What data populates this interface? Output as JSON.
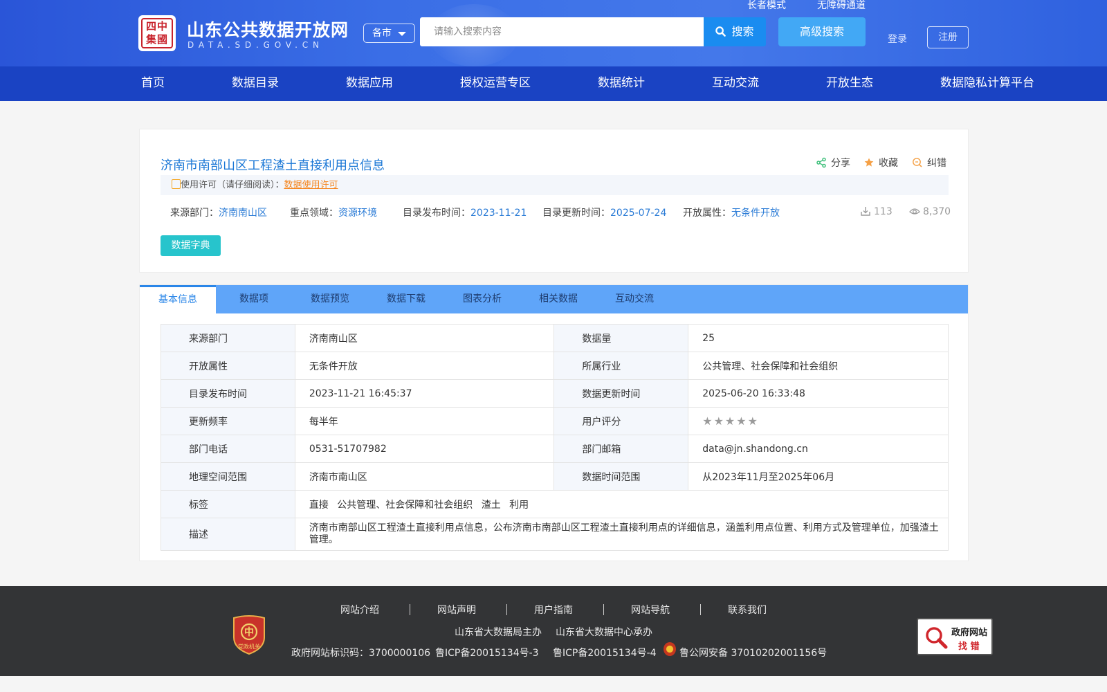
{
  "header": {
    "logo_seal": "四中\n集國",
    "site_title": "山东公共数据开放网",
    "site_domain": "DATA.SD.GOV.CN",
    "elder_mode": "长者模式",
    "accessibility": "无障碍通道",
    "city_select": "各市",
    "search_placeholder": "请输入搜索内容",
    "search_button": "搜索",
    "advanced_search": "高级搜索",
    "login": "登录",
    "register": "注册"
  },
  "nav": {
    "items": [
      "首页",
      "数据目录",
      "数据应用",
      "授权运营专区",
      "数据统计",
      "互动交流",
      "开放生态",
      "数据隐私计算平台"
    ]
  },
  "dataset": {
    "title": "济南市南部山区工程渣土直接利用点信息",
    "share": "分享",
    "favorite": "收藏",
    "report_error": "纠错",
    "license_prefix": "使用许可（请仔细阅读）：",
    "license_link": "数据使用许可",
    "source_label": "来源部门：",
    "source_value": "济南南山区",
    "domain_label": "重点领域：",
    "domain_value": "资源环境",
    "publish_label": "目录发布时间：",
    "publish_value": "2023-11-21",
    "update_label": "目录更新时间：",
    "update_value": "2025-07-24",
    "open_label": "开放属性：",
    "open_value": "无条件开放",
    "downloads": "113",
    "views": "8,370",
    "dict_button": "数据字典"
  },
  "tabs": [
    "基本信息",
    "数据项",
    "数据预览",
    "数据下载",
    "图表分析",
    "相关数据",
    "互动交流"
  ],
  "info_table": {
    "rows": [
      {
        "k1": "来源部门",
        "v1": "济南南山区",
        "k2": "数据量",
        "v2": "25"
      },
      {
        "k1": "开放属性",
        "v1": "无条件开放",
        "k2": "所属行业",
        "v2": "公共管理、社会保障和社会组织"
      },
      {
        "k1": "目录发布时间",
        "v1": "2023-11-21 16:45:37",
        "k2": "数据更新时间",
        "v2": "2025-06-20 16:33:48"
      },
      {
        "k1": "更新频率",
        "v1": "每半年",
        "k2": "用户评分",
        "v2": ""
      },
      {
        "k1": "部门电话",
        "v1": "0531-51707982",
        "k2": "部门邮箱",
        "v2": "data@jn.shandong.cn"
      },
      {
        "k1": "地理空间范围",
        "v1": "济南市南山区",
        "k2": "数据时间范围",
        "v2": "从2023年11月至2025年06月"
      }
    ],
    "tags_label": "标签",
    "tags": [
      "直接",
      "公共管理、社会保障和社会组织",
      "渣土",
      "利用"
    ],
    "desc_label": "描述",
    "desc_value": "济南市南部山区工程渣土直接利用点信息，公布济南市南部山区工程渣土直接利用点的详细信息，涵盖利用点位置、利用方式及管理单位，加强渣土管理。",
    "rating_stars": 0
  },
  "footer": {
    "links": [
      "网站介绍",
      "网站声明",
      "用户指南",
      "网站导航",
      "联系我们"
    ],
    "host": "山东省大数据局主办",
    "organizer": "山东省大数据中心承办",
    "site_code": "政府网站标识码：3700000106",
    "icp1": "鲁ICP备20015134号-3",
    "icp2": "鲁ICP备20015134号-4",
    "police": "鲁公网安备 37010202001156号",
    "badge_text": "党政机关",
    "error_box_line1": "政府网站",
    "error_box_line2": "找 错"
  },
  "colors": {
    "header_blue": "#3a6ee6",
    "nav_blue": "#1a43c3",
    "link_blue": "#2a7bd6",
    "tab_bar": "#5fa5f9",
    "dict_teal": "#27c4cc",
    "license_orange": "#f5861f"
  }
}
